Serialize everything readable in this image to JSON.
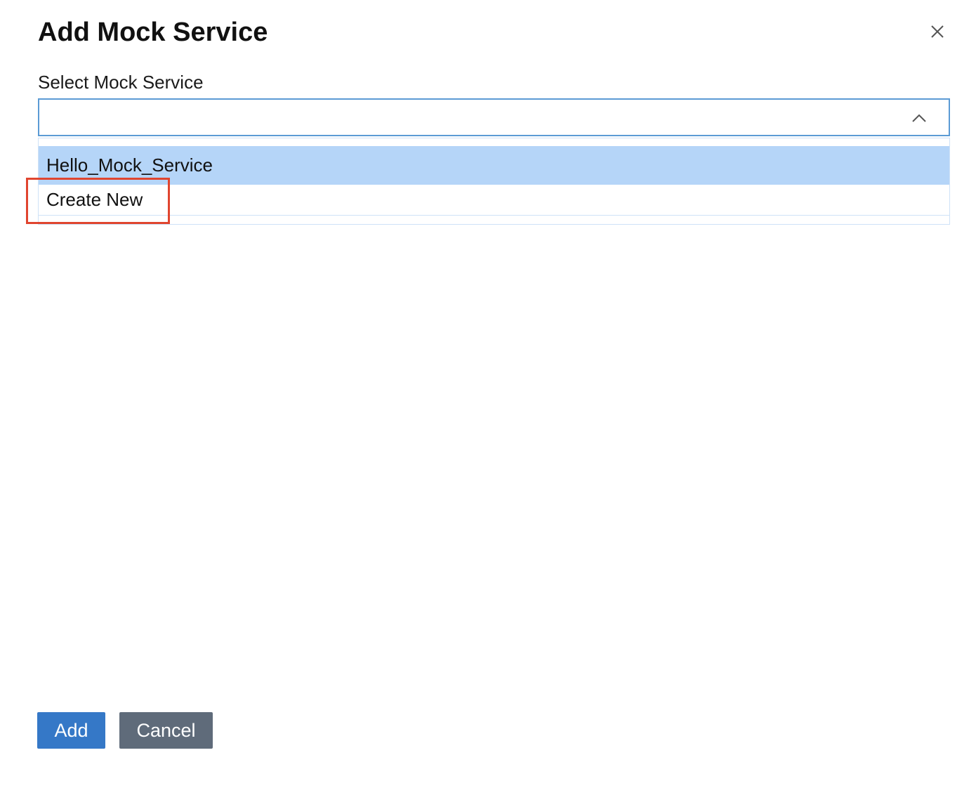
{
  "dialog": {
    "title": "Add Mock Service",
    "close_icon": "close-icon"
  },
  "field": {
    "label": "Select Mock Service",
    "value": "",
    "chevron_icon": "chevron-up-icon",
    "state": "open"
  },
  "dropdown": {
    "options": [
      {
        "label": "Hello_Mock_Service",
        "highlighted": true
      },
      {
        "label": "Create New",
        "highlighted": false
      }
    ]
  },
  "annotation": {
    "target": "Create New",
    "color": "#e0452f"
  },
  "footer": {
    "add_label": "Add",
    "cancel_label": "Cancel"
  },
  "colors": {
    "accent": "#3578c7",
    "secondary_button": "#5f6b7a",
    "option_highlight": "#b5d5f8",
    "select_border": "#5b9bd5"
  }
}
